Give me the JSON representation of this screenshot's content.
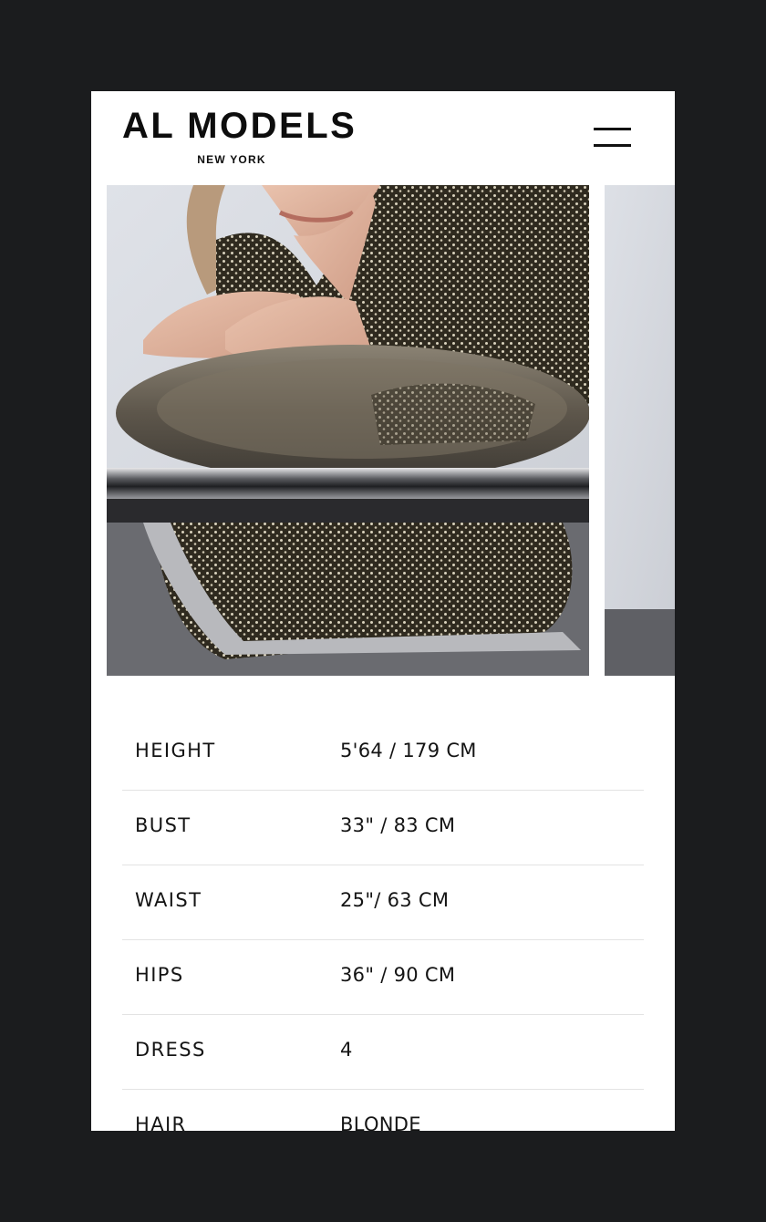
{
  "header": {
    "logo_main": "AL MODELS",
    "logo_sub": "NEW YORK",
    "menu_icon": "hamburger-menu-icon"
  },
  "gallery": {
    "images": [
      "model photo: woman in polka-dot dress leaning on glass and chrome table",
      "next model photo (partially visible)"
    ]
  },
  "stats": {
    "rows": [
      {
        "label": "HEIGHT",
        "value": "5'64 / 179 CM"
      },
      {
        "label": "BUST",
        "value": "33\" / 83 CM"
      },
      {
        "label": "WAIST",
        "value": "25\"/ 63 CM"
      },
      {
        "label": "HIPS",
        "value": "36\" / 90 CM"
      },
      {
        "label": "DRESS",
        "value": "4"
      },
      {
        "label": "HAIR",
        "value": "BLONDE"
      }
    ]
  },
  "colors": {
    "background": "#1b1c1e",
    "page": "#ffffff",
    "text": "#141414",
    "divider": "#e3e3e3"
  }
}
